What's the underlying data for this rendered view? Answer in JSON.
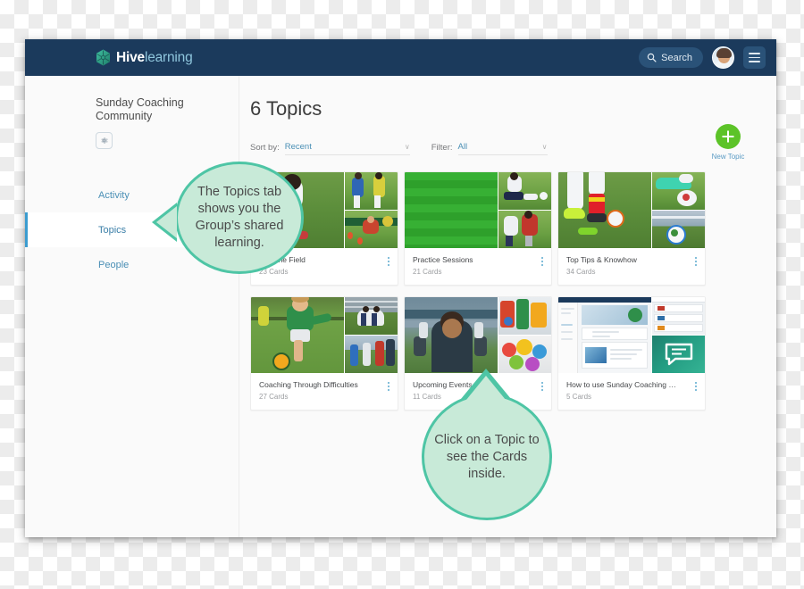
{
  "window": {
    "topbar": {
      "brand_hive": "Hive",
      "brand_learning": "learning",
      "search_label": "Search",
      "search_icon": "search-icon",
      "menu_icon": "hamburger-menu-icon",
      "avatar_name": "user-avatar",
      "bg_color": "#1b3a5c"
    },
    "sidebar": {
      "group_title": "Sunday Coaching Community",
      "settings_icon": "gear-icon",
      "items": [
        {
          "label": "Activity",
          "active": false
        },
        {
          "label": "Topics",
          "active": true
        },
        {
          "label": "People",
          "active": false
        }
      ]
    },
    "main": {
      "title": "6 Topics",
      "new_topic": {
        "label": "New Topic",
        "icon": "plus-icon",
        "color": "#5cc328"
      },
      "controls": [
        {
          "label": "Sort by:",
          "value": "Recent",
          "caret": "∨"
        },
        {
          "label": "Filter:",
          "value": "All",
          "caret": "∨"
        }
      ],
      "cards": [
        {
          "title": "...m The Field",
          "count": "23 Cards",
          "kebab": "more-options-icon",
          "art": "soccer-kids"
        },
        {
          "title": "Practice Sessions",
          "count": "21 Cards",
          "kebab": "more-options-icon",
          "art": "pitch-diagram"
        },
        {
          "title": "Top Tips & Knowhow",
          "count": "34 Cards",
          "kebab": "more-options-icon",
          "art": "boots-and-ball"
        },
        {
          "title": "Coaching Through Difficulties",
          "count": "27 Cards",
          "kebab": "more-options-icon",
          "art": "boy-kicking"
        },
        {
          "title": "Upcoming Events",
          "count": "11 Cards",
          "kebab": "more-options-icon",
          "art": "stadium-crowd"
        },
        {
          "title": "How to use Sunday Coaching Com...",
          "count": "5 Cards",
          "kebab": "more-options-icon",
          "art": "app-screenshot"
        }
      ]
    }
  },
  "callouts": [
    {
      "id": "topics",
      "text": "The Topics tab shows you the Group’s shared learning.",
      "fill": "#c8ead8",
      "stroke": "#4ec5a5"
    },
    {
      "id": "cards",
      "text": "Click on a Topic to see the Cards inside.",
      "fill": "#c8ead8",
      "stroke": "#4ec5a5"
    }
  ]
}
